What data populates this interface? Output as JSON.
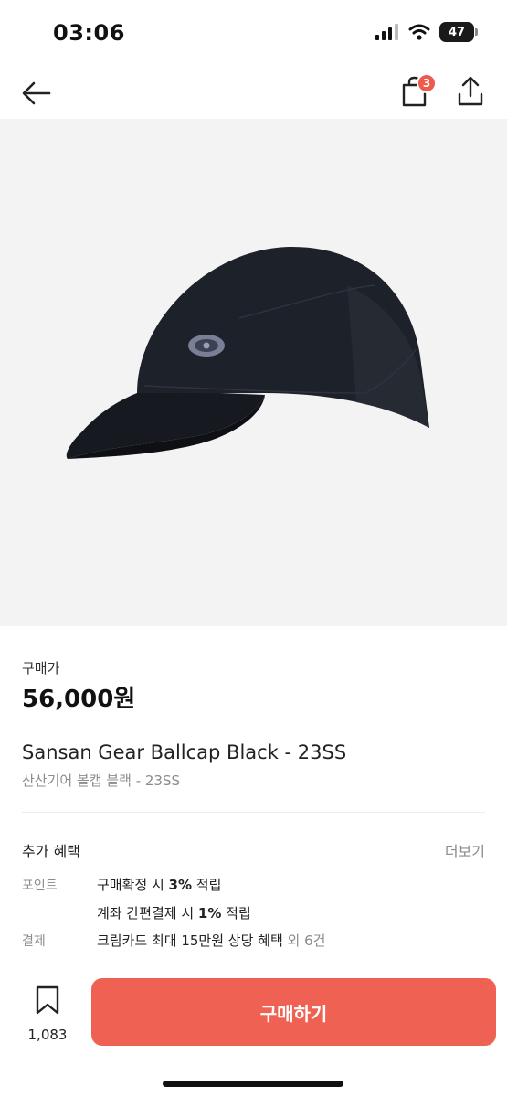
{
  "status_bar": {
    "time": "03:06",
    "battery": "47"
  },
  "header": {
    "cart_count": "3"
  },
  "price": {
    "label": "구매가",
    "value": "56,000원"
  },
  "product": {
    "name_en": "Sansan Gear Ballcap Black - 23SS",
    "name_ko": "산산기어 볼캡 블랙 - 23SS"
  },
  "benefits": {
    "title": "추가 혜택",
    "more": "더보기",
    "point_label": "포인트",
    "point_line1_pre": "구매확정 시 ",
    "point_line1_bold": "3%",
    "point_line1_post": " 적립",
    "point_line2_pre": "계좌 간편결제 시 ",
    "point_line2_bold": "1%",
    "point_line2_post": " 적립",
    "payment_label": "결제",
    "payment_text": "크림카드 최대 15만원 상당 혜택",
    "payment_extra": "외 6건"
  },
  "bottom": {
    "bookmark_count": "1,083",
    "buy_label": "구매하기"
  },
  "colors": {
    "accent": "#ef6253",
    "badge": "#ef5a4c",
    "image_bg": "#f3f3f3"
  }
}
